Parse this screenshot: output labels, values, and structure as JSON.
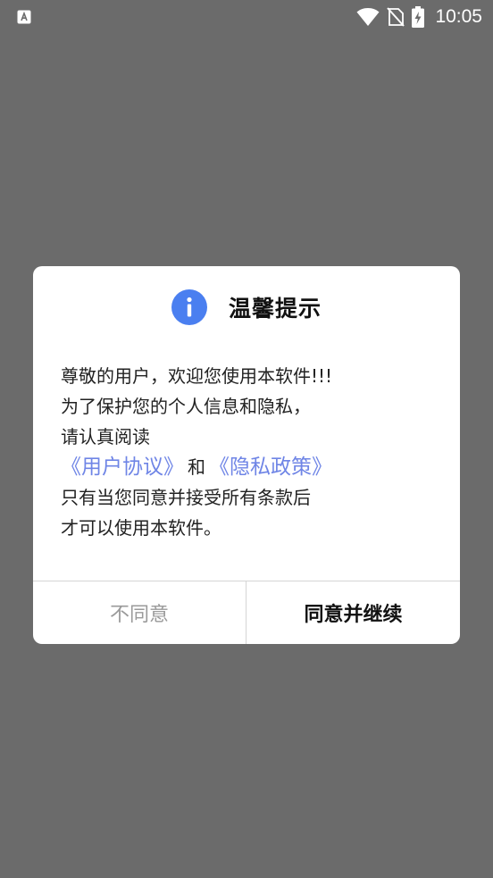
{
  "status_bar": {
    "time": "10:05",
    "icons": [
      "app-notification-icon",
      "wifi-icon",
      "no-sim-icon",
      "battery-charging-icon"
    ]
  },
  "dialog": {
    "icon": "info-icon",
    "accent_color": "#4a7ff0",
    "title": "温馨提示",
    "body": {
      "line1": "尊敬的用户，欢迎您使用本软件!!!",
      "line2": "为了保护您的个人信息和隐私，",
      "line3": "请认真阅读",
      "user_agreement_link": "《用户协议》",
      "and_text": "和",
      "privacy_policy_link": "《隐私政策》",
      "line5": "只有当您同意并接受所有条款后",
      "line6": "才可以使用本软件。"
    },
    "link_color": "#6f85e6",
    "buttons": {
      "disagree": "不同意",
      "agree": "同意并继续"
    }
  }
}
